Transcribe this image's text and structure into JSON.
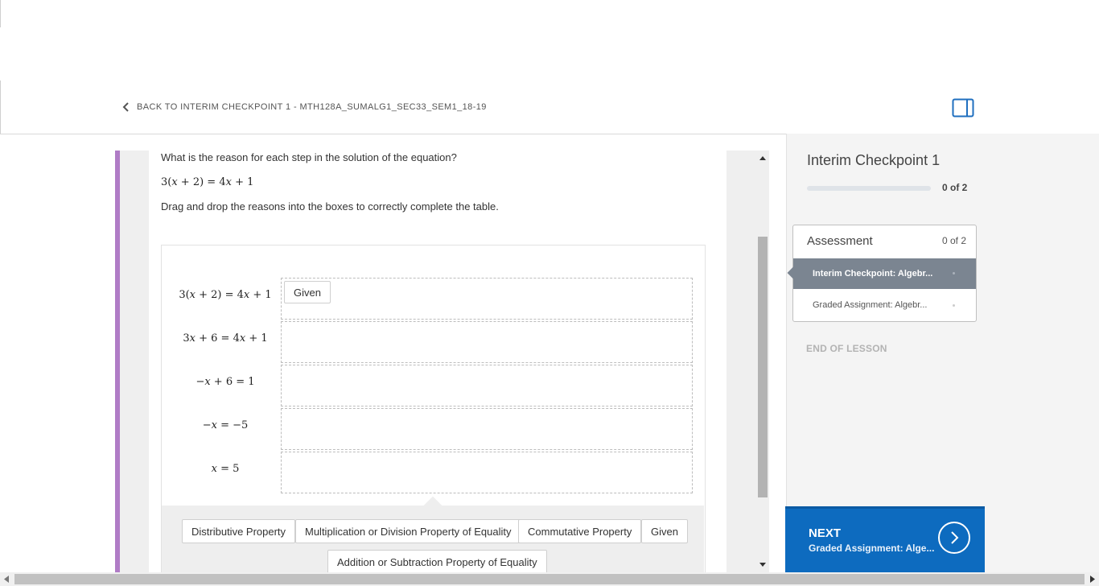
{
  "header": {
    "back_label": "BACK TO INTERIM CHECKPOINT 1 - MTH128A_SUMALG1_SEC33_SEM1_18-19",
    "back_icon": "chevron-left-icon",
    "panel_icon": "sidebar-toggle-icon"
  },
  "question": {
    "prompt": "What is the reason for each step in the solution of the equation?",
    "equation": "3(𝑥 + 2) = 4𝑥 + 1",
    "instructions": "Drag and drop the reasons into the boxes to correctly complete the table."
  },
  "table": {
    "rows": [
      {
        "equation": "3(𝑥 + 2) = 4𝑥 + 1",
        "placed": "Given"
      },
      {
        "equation": "3𝑥 + 6 = 4𝑥 + 1",
        "placed": ""
      },
      {
        "equation": "−𝑥 + 6 = 1",
        "placed": ""
      },
      {
        "equation": "−𝑥 = −5",
        "placed": ""
      },
      {
        "equation": "𝑥 = 5",
        "placed": ""
      }
    ]
  },
  "bank": {
    "choices": [
      "Distributive Property",
      "Multiplication or Division Property of Equality",
      "Commutative Property",
      "Given",
      "Addition or Subtraction Property of Equality"
    ]
  },
  "sidebar": {
    "title": "Interim Checkpoint 1",
    "progress_text": "0 of 2",
    "progress_fraction": 0,
    "lesson": {
      "heading": "Assessment",
      "count": "0 of 2",
      "items": [
        {
          "label": "Interim Checkpoint: Algebr...",
          "active": true
        },
        {
          "label": "Graded Assignment: Algebr...",
          "active": false
        }
      ]
    },
    "end_label": "END OF LESSON",
    "next": {
      "label": "NEXT",
      "subtitle": "Graded Assignment: Alge...",
      "icon": "chevron-right-icon"
    }
  },
  "colors": {
    "accent_purple": "#b07cc6",
    "next_blue": "#0d6bbf",
    "active_item": "#7b8591"
  }
}
